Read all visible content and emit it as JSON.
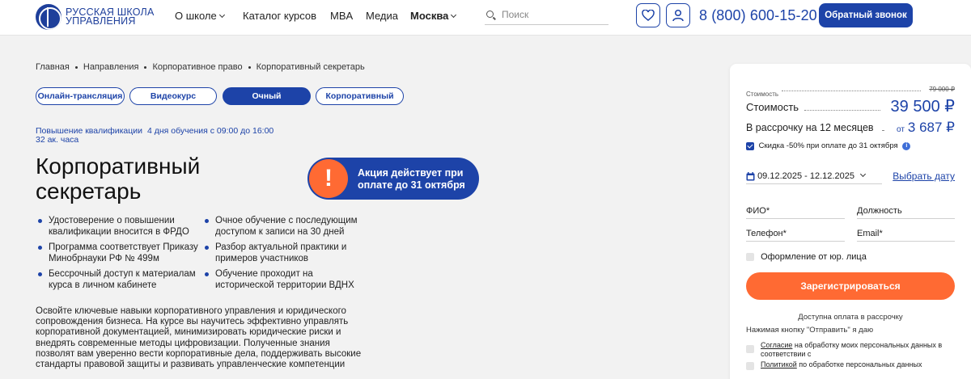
{
  "header": {
    "logo_line1": "Русская школа",
    "logo_line2": "управления",
    "nav": [
      {
        "label": "О школе"
      },
      {
        "label": "Каталог курсов"
      },
      {
        "label": "MBA"
      },
      {
        "label": "Медиа"
      },
      {
        "label": "Москва"
      }
    ],
    "search_placeholder": "Поиск",
    "phone": "8 (800) 600-15-20",
    "callback_label": "Обратный звонок",
    "icons": [
      "heart-icon",
      "user-icon",
      "search-icon"
    ]
  },
  "breadcrumb": [
    "Главная",
    "Направления",
    "Корпоративное право",
    "Корпоративный секретарь"
  ],
  "formats": [
    {
      "label": "Онлайн-трансляция",
      "active": false
    },
    {
      "label": "Видеокурс",
      "active": false
    },
    {
      "label": "Очный",
      "active": true
    },
    {
      "label": "Корпоративный",
      "active": false
    }
  ],
  "course": {
    "type": "Повышение квалификации",
    "schedule": "4 дня обучения с 09:00 до 16:00",
    "hours": "32 ак. часа",
    "title": "Корпоративный секретарь",
    "promo": "Акция действует при оплате до 31 октября",
    "promo_icon": "!",
    "bullets": [
      "Удостоверение о повышении квалификации вносится в ФРДО",
      "Программа соответствует Приказу Минобрнауки РФ № 499м",
      "Бессрочный доступ к материалам курса в личном кабинете",
      "Очное обучение с последующим доступом к записи на 30 дней",
      "Разбор актуальной практики и примеров участников",
      "Обучение проходит на исторической территории ВДНХ"
    ],
    "description": "Освойте ключевые навыки корпоративного управления и юридического сопровождения бизнеса. На курсе вы научитесь эффективно управлять корпоративной документацией, минимизировать юридические риски и внедрять современные методы цифровизации. Полученные знания позволят вам уверенно вести корпоративные дела, поддерживать высокие стандарты правовой защиты и развивать управленческие компетенции"
  },
  "order": {
    "old_label": "Стоимость",
    "old_price": "79 000 ₽",
    "cost_label": "Стоимость",
    "cost": "39 500 ₽",
    "installment_label": "В рассрочку на 12 месяцев",
    "installment_prefix": "от",
    "installment": "3 687 ₽",
    "discount": "Скидка -50% при оплате до 31 октября",
    "discount_checked": true,
    "dates": "09.12.2025 - 12.12.2025",
    "choose_date": "Выбрать дату",
    "fields": {
      "name": "ФИО*",
      "position": "Должность",
      "phone": "Телефон*",
      "email": "Email*"
    },
    "legal_entity": "Оформление от юр. лица",
    "submit": "Зарегистрироваться",
    "installment_note": "Доступна оплата в рассрочку",
    "press_note": "Нажимая кнопку \"Отправить\" я даю",
    "consent1_link": "Согласие",
    "consent1_text": " на обработку моих персональных данных в соответствии с",
    "consent2_link": "Политикой",
    "consent2_text": " по обработке персональных данных"
  },
  "colors": {
    "brand": "#1d43a8",
    "accent": "#ff6a33"
  }
}
